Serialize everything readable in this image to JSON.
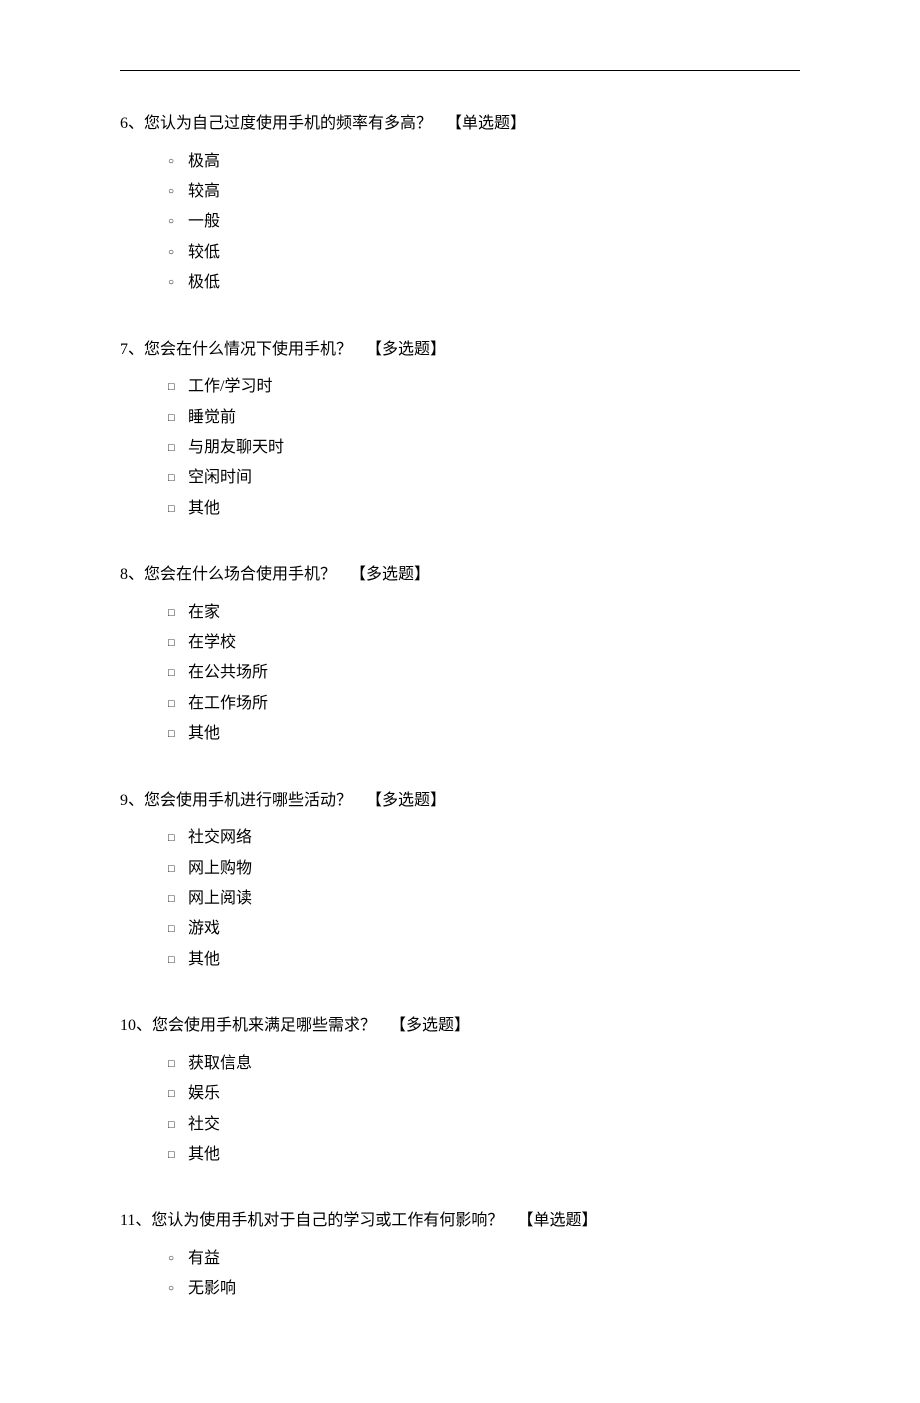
{
  "questions": [
    {
      "number": "6、",
      "text": "您认为自己过度使用手机的频率有多高？",
      "type_tag": "【单选题】",
      "input": "radio",
      "options": [
        "极高",
        "较高",
        "一般",
        "较低",
        "极低"
      ]
    },
    {
      "number": "7、",
      "text": "您会在什么情况下使用手机？",
      "type_tag": "【多选题】",
      "input": "checkbox",
      "options": [
        "工作/学习时",
        "睡觉前",
        "与朋友聊天时",
        "空闲时间",
        "其他"
      ]
    },
    {
      "number": "8、",
      "text": "您会在什么场合使用手机？",
      "type_tag": "【多选题】",
      "input": "checkbox",
      "options": [
        "在家",
        "在学校",
        "在公共场所",
        "在工作场所",
        "其他"
      ]
    },
    {
      "number": "9、",
      "text": "您会使用手机进行哪些活动？",
      "type_tag": "【多选题】",
      "input": "checkbox",
      "options": [
        "社交网络",
        "网上购物",
        "网上阅读",
        "游戏",
        "其他"
      ]
    },
    {
      "number": "10、",
      "text": "您会使用手机来满足哪些需求？",
      "type_tag": "【多选题】",
      "input": "checkbox",
      "options": [
        "获取信息",
        "娱乐",
        "社交",
        "其他"
      ]
    },
    {
      "number": "11、",
      "text": "您认为使用手机对于自己的学习或工作有何影响？",
      "type_tag": "【单选题】",
      "input": "radio",
      "options": [
        "有益",
        "无影响"
      ]
    }
  ]
}
